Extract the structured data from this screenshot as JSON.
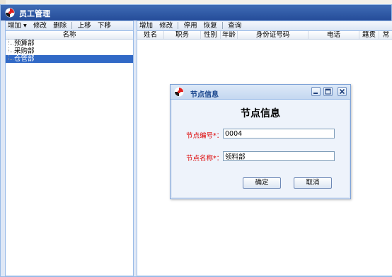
{
  "window": {
    "title": "员工管理"
  },
  "left": {
    "toolbar": [
      {
        "label": "增加",
        "dropdown": true
      },
      {
        "label": "修改"
      },
      {
        "label": "删除"
      },
      {
        "label": "上移"
      },
      {
        "label": "下移"
      }
    ],
    "column_header": "名称",
    "tree": [
      {
        "label": "预算部",
        "selected": false
      },
      {
        "label": "采购部",
        "selected": false
      },
      {
        "label": "仓管部",
        "selected": true
      }
    ]
  },
  "right": {
    "toolbar": [
      {
        "label": "增加"
      },
      {
        "label": "修改"
      },
      {
        "label": "停用"
      },
      {
        "label": "恢复"
      },
      {
        "label": "查询"
      }
    ],
    "columns": [
      "姓名",
      "职务",
      "性别",
      "年龄",
      "身份证号码",
      "电话",
      "籍贯",
      "常"
    ]
  },
  "dialog": {
    "title": "节点信息",
    "heading": "节点信息",
    "code_label": "节点编号*：",
    "code_value": "0004",
    "name_label": "节点名称*：",
    "name_value": "领料部",
    "ok_label": "确定",
    "cancel_label": "取消"
  },
  "colors": {
    "title_bar": "#2f5ca6",
    "selection": "#3169c6",
    "required_label": "#dd0000",
    "dialog_title_text": "#15428b"
  }
}
